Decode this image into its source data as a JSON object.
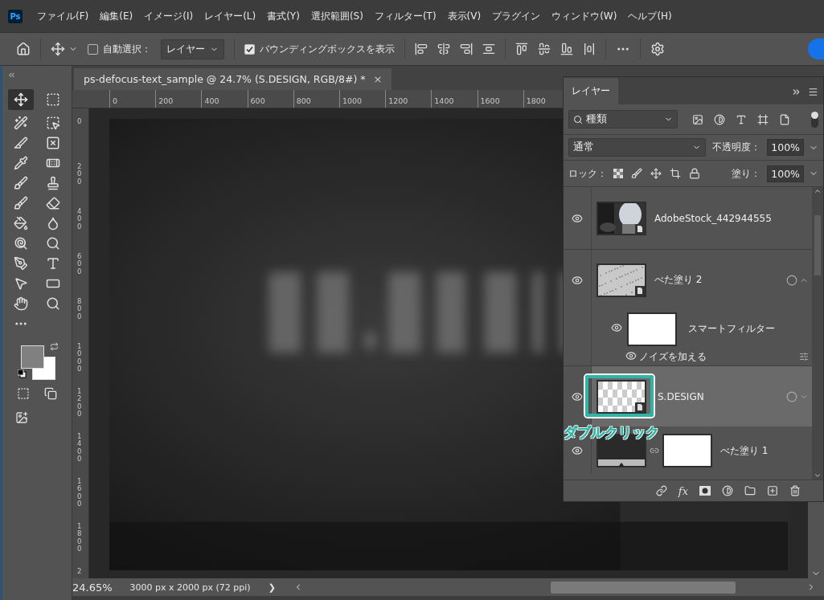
{
  "app": {
    "logo": "Ps"
  },
  "menu": [
    {
      "label": "ファイル(F)"
    },
    {
      "label": "編集(E)"
    },
    {
      "label": "イメージ(I)"
    },
    {
      "label": "レイヤー(L)"
    },
    {
      "label": "書式(Y)"
    },
    {
      "label": "選択範囲(S)"
    },
    {
      "label": "フィルター(T)"
    },
    {
      "label": "表示(V)"
    },
    {
      "label": "プラグイン"
    },
    {
      "label": "ウィンドウ(W)"
    },
    {
      "label": "ヘルプ(H)"
    }
  ],
  "options_bar": {
    "auto_select": {
      "label": "自動選択：",
      "checked": false
    },
    "auto_select_target": "レイヤー",
    "show_transform": {
      "label": "バウンディングボックスを表示",
      "checked": true
    }
  },
  "document_tab": {
    "title": "ps-defocus-text_sample @ 24.7% (S.DESIGN, RGB/8#) *",
    "close": "×",
    "selected": true
  },
  "rulers": {
    "horizontal": [
      "0",
      "200",
      "400",
      "600",
      "800",
      "1000",
      "1200",
      "1400",
      "1600",
      "1800"
    ],
    "vertical": [
      "0",
      "200",
      "400",
      "600",
      "800",
      "1000",
      "1200",
      "1400",
      "1600",
      "1800",
      "2"
    ]
  },
  "layers_panel": {
    "tab": "レイヤー",
    "filter": "種類",
    "blend_mode": "通常",
    "opacity_label": "不透明度：",
    "opacity": "100%",
    "lock_label": "ロック：",
    "fill_label": "塗り：",
    "fill": "100%",
    "layers": [
      {
        "name": "AdobeStock_442944555",
        "visible": true,
        "selected": false
      },
      {
        "kind": "smart",
        "name": "べた塗り 2",
        "visible": true,
        "selected": false,
        "expanded": true,
        "children": [
          {
            "kind": "filter_mask",
            "name": "スマートフィルター",
            "visible": true
          },
          {
            "kind": "filter",
            "name": "ノイズを加える",
            "visible": true
          }
        ]
      },
      {
        "kind": "text_smart",
        "name": "S.DESIGN",
        "visible": true,
        "selected": true,
        "expanded": false
      },
      {
        "kind": "fill",
        "name": "べた塗り 1",
        "visible": true,
        "selected": false
      }
    ],
    "fx_label": "fx",
    "annotation": "ダブルクリック"
  },
  "status_bar": {
    "zoom": "24.65%",
    "doc_info": "3000 px x 2000 px (72 ppi)",
    "arrow": "❯"
  }
}
